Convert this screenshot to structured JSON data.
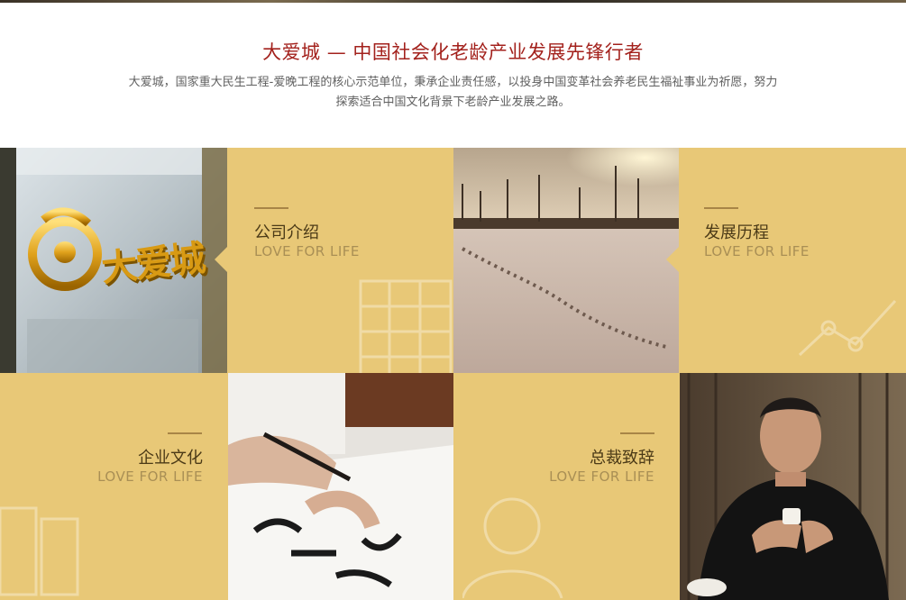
{
  "header": {
    "title": "大爱城 — 中国社会化老龄产业发展先锋行者",
    "description": "大爱城，国家重大民生工程-爱晚工程的核心示范单位，秉承企业责任感，以投身中国变革社会养老民生福祉事业为祈愿，努力探索适合中国文化背景下老龄产业发展之路。"
  },
  "cards": [
    {
      "title": "公司介绍",
      "subtitle": "LOVE FOR LIFE"
    },
    {
      "title": "发展历程",
      "subtitle": "LOVE FOR LIFE"
    },
    {
      "title": "企业文化",
      "subtitle": "LOVE FOR LIFE"
    },
    {
      "title": "总裁致辞",
      "subtitle": "LOVE FOR LIFE"
    }
  ],
  "images": {
    "logo_text": "大爱城"
  },
  "colors": {
    "accent_red": "#a3211c",
    "gold": "#e8c877",
    "card_title": "#4b3a17",
    "card_subtitle": "#a98f55"
  }
}
